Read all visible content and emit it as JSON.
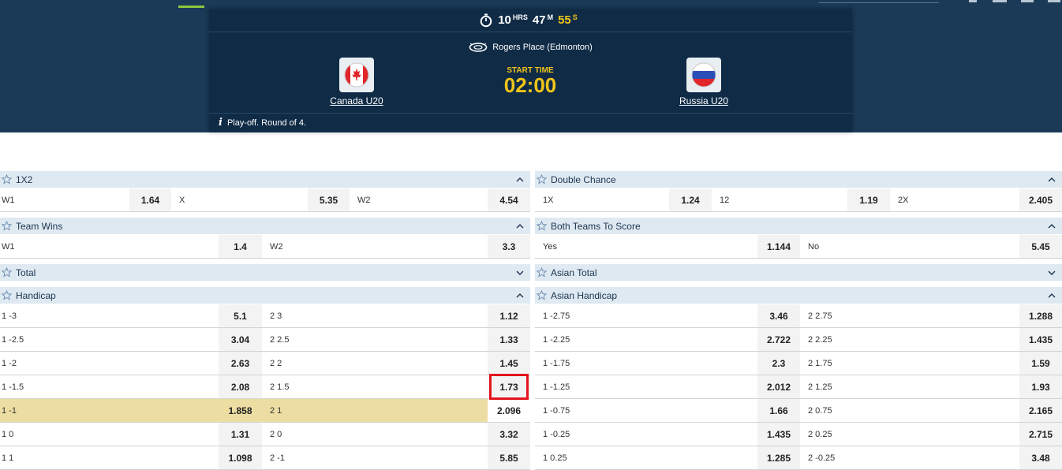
{
  "match": {
    "timer": {
      "hours": "10",
      "hours_unit": "HRS",
      "minutes": "47",
      "minutes_unit": "M",
      "seconds": "55",
      "seconds_unit": "S"
    },
    "venue": "Rogers Place (Edmonton)",
    "home_team": "Canada U20",
    "away_team": "Russia U20",
    "start_label": "START TIME",
    "start_time": "02:00",
    "info": "Play-off. Round of 4."
  },
  "markets_left": {
    "onextwo": {
      "title": "1X2",
      "row": [
        {
          "label": "W1",
          "odd": "1.64"
        },
        {
          "label": "X",
          "odd": "5.35"
        },
        {
          "label": "W2",
          "odd": "4.54"
        }
      ]
    },
    "team_wins": {
      "title": "Team Wins",
      "row": [
        {
          "label": "W1",
          "odd": "1.4"
        },
        {
          "label": "W2",
          "odd": "3.3"
        }
      ]
    },
    "total": {
      "title": "Total"
    },
    "handicap": {
      "title": "Handicap",
      "rows": [
        {
          "l1": "1 -3",
          "o1": "5.1",
          "l2": "2 3",
          "o2": "1.12"
        },
        {
          "l1": "1 -2.5",
          "o1": "3.04",
          "l2": "2 2.5",
          "o2": "1.33"
        },
        {
          "l1": "1 -2",
          "o1": "2.63",
          "l2": "2 2",
          "o2": "1.45"
        },
        {
          "l1": "1 -1.5",
          "o1": "2.08",
          "l2": "2 1.5",
          "o2": "1.73"
        },
        {
          "l1": "1 -1",
          "o1": "1.858",
          "l2": "2 1",
          "o2": "2.096"
        },
        {
          "l1": "1 0",
          "o1": "1.31",
          "l2": "2 0",
          "o2": "3.32"
        },
        {
          "l1": "1 1",
          "o1": "1.098",
          "l2": "2 -1",
          "o2": "5.85"
        }
      ]
    }
  },
  "markets_right": {
    "double_chance": {
      "title": "Double Chance",
      "row": [
        {
          "label": "1X",
          "odd": "1.24"
        },
        {
          "label": "12",
          "odd": "1.19"
        },
        {
          "label": "2X",
          "odd": "2.405"
        }
      ]
    },
    "btts": {
      "title": "Both Teams To Score",
      "row": [
        {
          "label": "Yes",
          "odd": "1.144"
        },
        {
          "label": "No",
          "odd": "5.45"
        }
      ]
    },
    "asian_total": {
      "title": "Asian Total"
    },
    "asian_handicap": {
      "title": "Asian Handicap",
      "rows": [
        {
          "l1": "1 -2.75",
          "o1": "3.46",
          "l2": "2 2.75",
          "o2": "1.288"
        },
        {
          "l1": "1 -2.25",
          "o1": "2.722",
          "l2": "2 2.25",
          "o2": "1.435"
        },
        {
          "l1": "1 -1.75",
          "o1": "2.3",
          "l2": "2 1.75",
          "o2": "1.59"
        },
        {
          "l1": "1 -1.25",
          "o1": "2.012",
          "l2": "2 1.25",
          "o2": "1.93"
        },
        {
          "l1": "1 -0.75",
          "o1": "1.66",
          "l2": "2 0.75",
          "o2": "2.165"
        },
        {
          "l1": "1 -0.25",
          "o1": "1.435",
          "l2": "2 0.25",
          "o2": "2.715"
        },
        {
          "l1": "1 0.25",
          "o1": "1.285",
          "l2": "2 -0.25",
          "o2": "3.48"
        }
      ]
    }
  },
  "colors": {
    "header_bg": "#1a3a57",
    "card_bg": "#0f2b46",
    "accent_yellow": "#f0c419",
    "highlight_row": "#ecdda3",
    "selected_border": "#e3141e"
  },
  "icons": {
    "timer": "stopwatch-icon",
    "venue": "stadium-icon",
    "info": "info-icon",
    "star": "star-icon",
    "collapse": "chevron-up-icon",
    "expand": "chevron-down-icon"
  }
}
